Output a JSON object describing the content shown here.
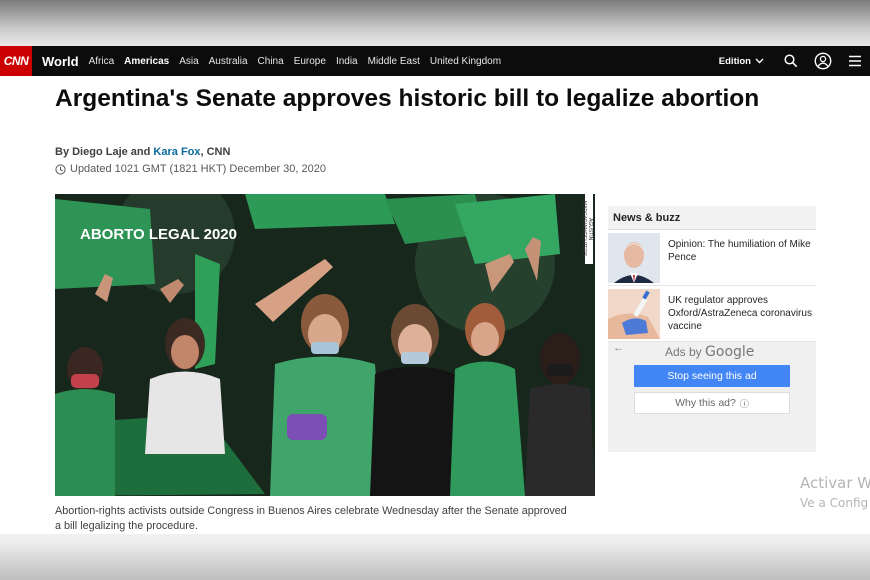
{
  "nav": {
    "logo": "CNN",
    "section": "World",
    "items": [
      {
        "label": "Africa",
        "active": false
      },
      {
        "label": "Americas",
        "active": true
      },
      {
        "label": "Asia",
        "active": false
      },
      {
        "label": "Australia",
        "active": false
      },
      {
        "label": "China",
        "active": false
      },
      {
        "label": "Europe",
        "active": false
      },
      {
        "label": "India",
        "active": false
      },
      {
        "label": "Middle East",
        "active": false
      },
      {
        "label": "United Kingdom",
        "active": false
      }
    ],
    "edition_label": "Edition",
    "icons": [
      "chevron-down-icon",
      "search-icon",
      "user-icon",
      "menu-icon"
    ]
  },
  "article": {
    "headline": "Argentina's Senate approves historic bill to legalize abortion",
    "byline_prefix": "By Diego Laje and",
    "byline_author2": "Kara Fox",
    "byline_suffix": ", CNN",
    "updated": "Updated 1021 GMT (1821 HKT) December 30, 2020",
    "photo_sign_text": "ABORTO LEGAL 2020",
    "photo_credit": "AGUSTIN MARCARIAN/REUTERS",
    "caption": "Abortion-rights activists outside Congress in Buenos Aires celebrate Wednesday after the Senate approved a bill legalizing the procedure."
  },
  "sidebar": {
    "title": "News & buzz",
    "stories": [
      {
        "text": "Opinion: The humiliation of Mike Pence"
      },
      {
        "text": "UK regulator approves Oxford/AstraZeneca coronavirus vaccine"
      }
    ],
    "ad": {
      "back_glyph": "←",
      "ads_by": "Ads by",
      "google": "Google",
      "stop": "Stop seeing this ad",
      "why": "Why this ad?",
      "info_glyph": "ⓘ"
    }
  },
  "watermark": {
    "line1": "Activar W",
    "line2": "Ve a Config"
  },
  "colors": {
    "cnn_red": "#cc0000",
    "nav_bg": "#0c0c0c",
    "link_blue": "#0c6a9c",
    "ad_button_blue": "#4285f4"
  }
}
